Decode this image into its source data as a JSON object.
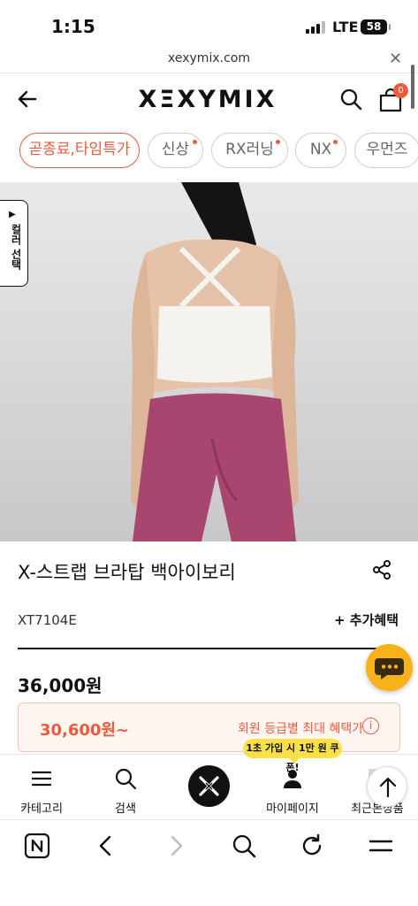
{
  "status": {
    "time": "1:15",
    "network": "LTE",
    "battery": "58"
  },
  "browser": {
    "url": "xexymix.com"
  },
  "header": {
    "logo": "XΞXYMIX",
    "cart_count": "0"
  },
  "chips": [
    {
      "label": "곧종료,타임특가",
      "new": false
    },
    {
      "label": "신상",
      "new": true
    },
    {
      "label": "RX러닝",
      "new": true
    },
    {
      "label": "NX",
      "new": true
    },
    {
      "label": "우먼즈",
      "new": false
    }
  ],
  "colors": {
    "accent": "#ef5a3c",
    "chat": "#f7b21a",
    "coupon": "#f9e046"
  },
  "color_select_label": "컬러 선택",
  "product": {
    "name": "X-스트랩 브라탑 백아이보리",
    "sku": "XT7104E",
    "benefit_label": "+ 추가혜택",
    "price": "36,000원",
    "member_price": "30,600원~",
    "member_text": "회원 등급별 최대 혜택가",
    "member_info_icon": "i"
  },
  "coupon_tip": "1초 가입 시 1만 원 쿠폰!",
  "bottom_nav": {
    "category": "카테고리",
    "search": "검색",
    "mypage": "마이페이지",
    "recent": "최근본상품"
  }
}
